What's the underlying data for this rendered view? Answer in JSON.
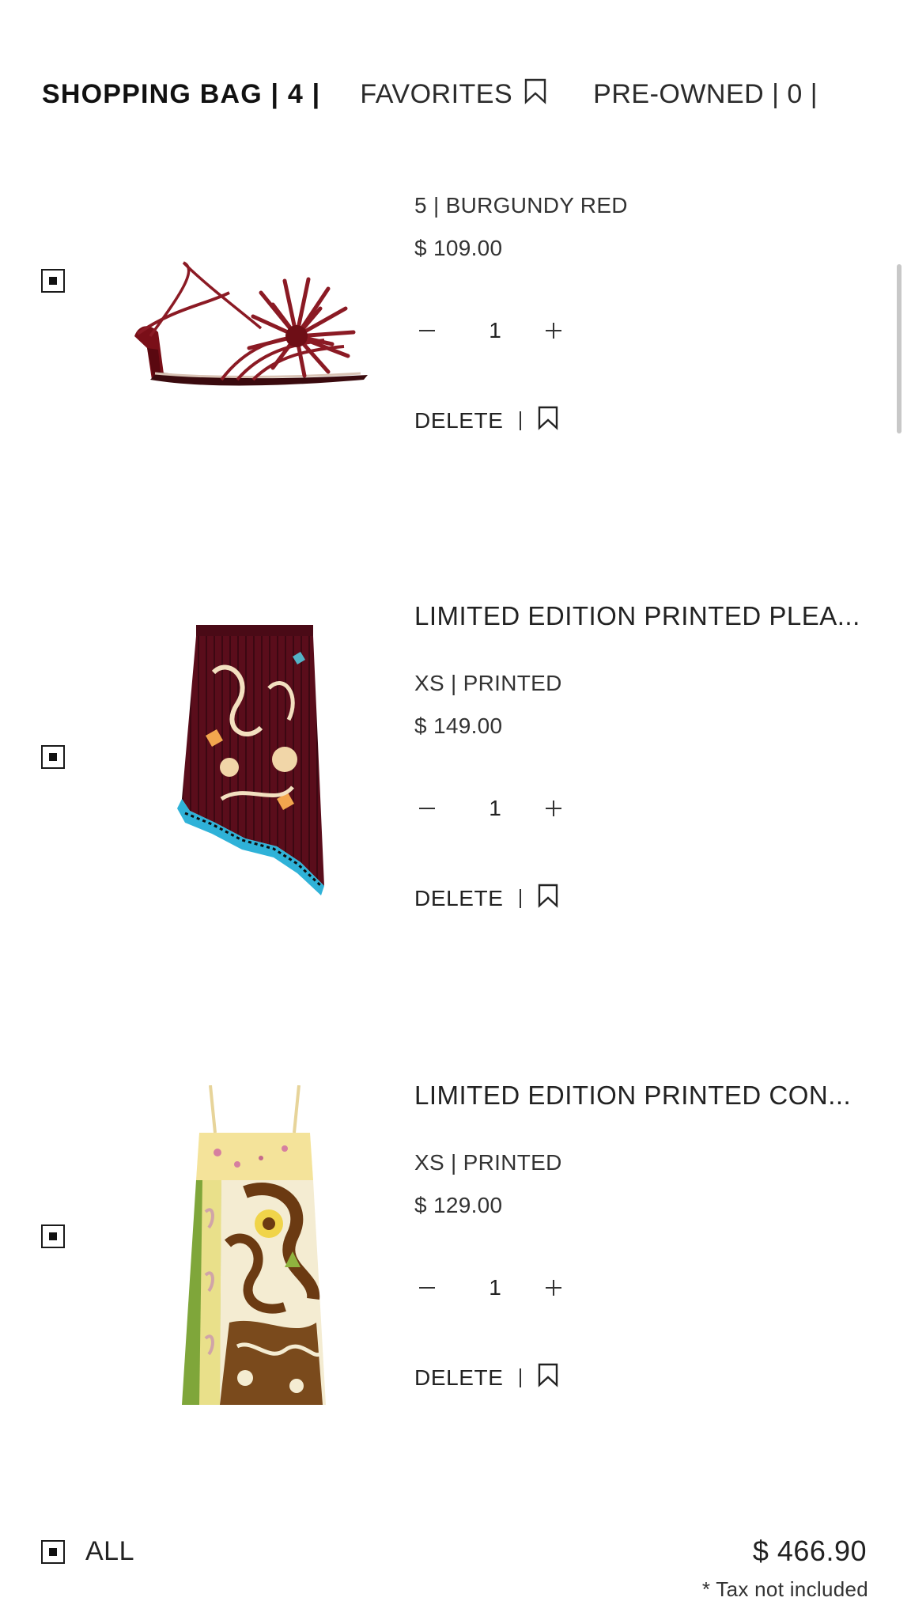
{
  "tabs": {
    "bag": "SHOPPING BAG | 4 |",
    "favorites": "FAVORITES",
    "preowned": "PRE-OWNED | 0 |"
  },
  "items": [
    {
      "name": "",
      "variant": "5 | BURGUNDY RED",
      "price": "$ 109.00",
      "quantity": "1",
      "delete_label": "DELETE",
      "selected": true,
      "image_icon": "burgundy-sandal-image"
    },
    {
      "name": "LIMITED EDITION PRINTED PLEA...",
      "variant": "XS | PRINTED",
      "price": "$ 149.00",
      "quantity": "1",
      "delete_label": "DELETE",
      "selected": true,
      "image_icon": "printed-pleated-skirt-image"
    },
    {
      "name": "LIMITED EDITION PRINTED CON...",
      "variant": "XS | PRINTED",
      "price": "$ 129.00",
      "quantity": "1",
      "delete_label": "DELETE",
      "selected": true,
      "image_icon": "printed-dress-image"
    }
  ],
  "footer": {
    "all_label": "ALL",
    "total": "$ 466.90",
    "tax_note": "* Tax not included"
  },
  "colors": {
    "text": "#1a1a1a",
    "burgundy": "#8b1a24",
    "scrollbar": "#c8c8c8"
  }
}
